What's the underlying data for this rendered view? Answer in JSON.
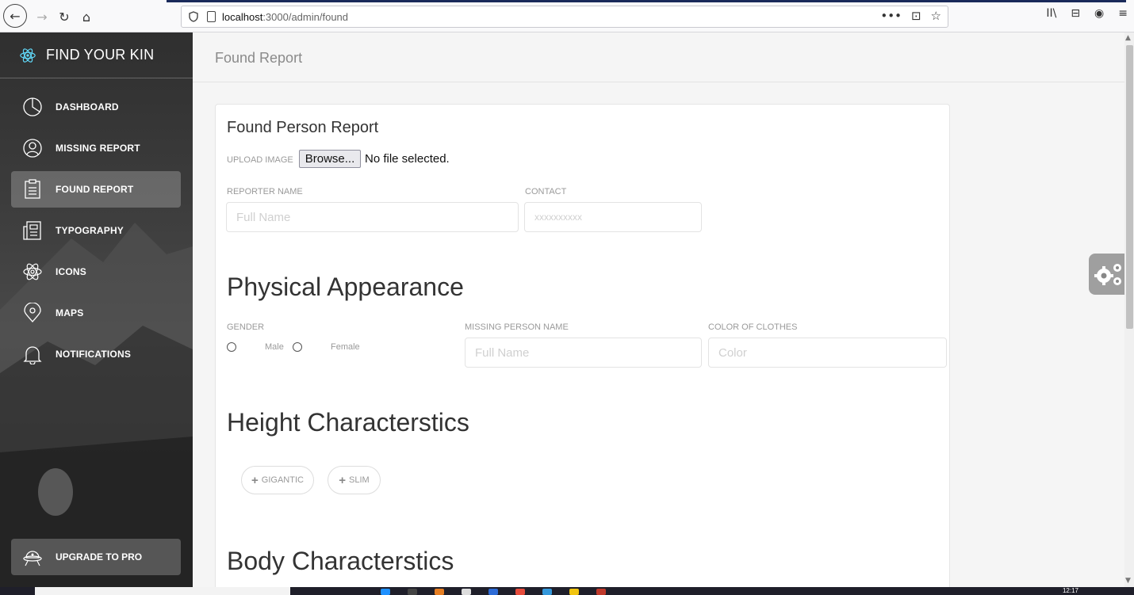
{
  "browser": {
    "url_host": "localhost",
    "url_path": ":3000/admin/found",
    "more_glyph": "•••",
    "pocket_glyph": "⊡",
    "star_glyph": "☆",
    "library_glyph": "II\\",
    "sidebar_glyph": "⊟",
    "account_glyph": "◉",
    "menu_glyph": "≡"
  },
  "sidebar": {
    "brand": "FIND YOUR KIN",
    "items": [
      {
        "label": "DASHBOARD",
        "icon": "pie-chart-icon"
      },
      {
        "label": "MISSING REPORT",
        "icon": "user-icon"
      },
      {
        "label": "FOUND REPORT",
        "icon": "clipboard-icon",
        "active": true
      },
      {
        "label": "TYPOGRAPHY",
        "icon": "news-icon"
      },
      {
        "label": "ICONS",
        "icon": "atom-icon"
      },
      {
        "label": "MAPS",
        "icon": "map-pin-icon"
      },
      {
        "label": "NOTIFICATIONS",
        "icon": "bell-icon"
      }
    ],
    "upgrade": "UPGRADE TO PRO"
  },
  "header": {
    "title": "Found Report"
  },
  "form": {
    "title": "Found Person Report",
    "upload_label": "UPLOAD IMAGE",
    "browse_label": "Browse...",
    "no_file": "No file selected.",
    "reporter_label": "REPORTER NAME",
    "reporter_placeholder": "Full Name",
    "contact_label": "CONTACT",
    "contact_placeholder": "xxxxxxxxxx",
    "physical_heading": "Physical Appearance",
    "gender_label": "GENDER",
    "gender_options": [
      "Male",
      "Female"
    ],
    "missing_name_label": "MISSING PERSON NAME",
    "missing_name_placeholder": "Full Name",
    "clothes_label": "COLOR OF CLOTHES",
    "clothes_placeholder": "Color",
    "height_heading": "Height Characterstics",
    "height_tags": [
      "GIGANTIC",
      "SLIM"
    ],
    "body_heading": "Body Characterstics"
  },
  "taskbar": {
    "clock": "12:17"
  },
  "colors": {
    "sidebar_bg": "#3a3a3a",
    "active_item": "rgba(255,255,255,0.23)",
    "heading": "#333333",
    "muted": "#9a9a9a"
  }
}
